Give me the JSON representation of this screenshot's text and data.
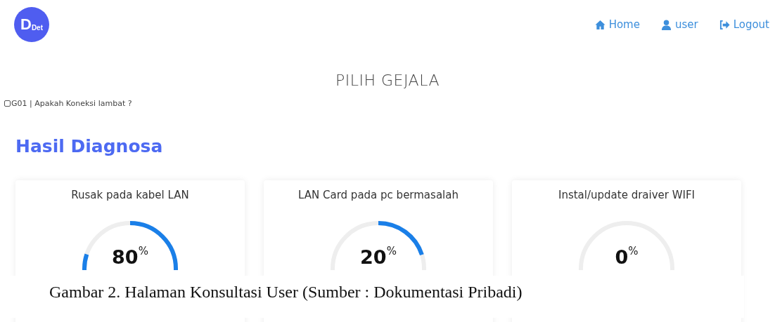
{
  "logo": {
    "letter": "D",
    "subscript": "Det"
  },
  "nav": [
    {
      "kind": "home",
      "label": "Home"
    },
    {
      "kind": "user",
      "label": "user"
    },
    {
      "kind": "logout",
      "label": "Logout"
    }
  ],
  "title": "PILIH GEJALA",
  "symptoms": [
    {
      "label": "G01 | Apakah Koneksi lambat ?",
      "checked": false
    }
  ],
  "results_heading": "Hasil Diagnosa",
  "results": [
    {
      "name": "Rusak pada kabel LAN",
      "value": "80",
      "unit": "%"
    },
    {
      "name": "LAN Card pada pc bermasalah",
      "value": "20",
      "unit": "%"
    },
    {
      "name": "Instal/update draiver WIFI",
      "value": "0",
      "unit": "%"
    }
  ],
  "caption": "Gambar 2. Halaman Konsultasi User (Sumber : Dokumentasi Pribadi)"
}
